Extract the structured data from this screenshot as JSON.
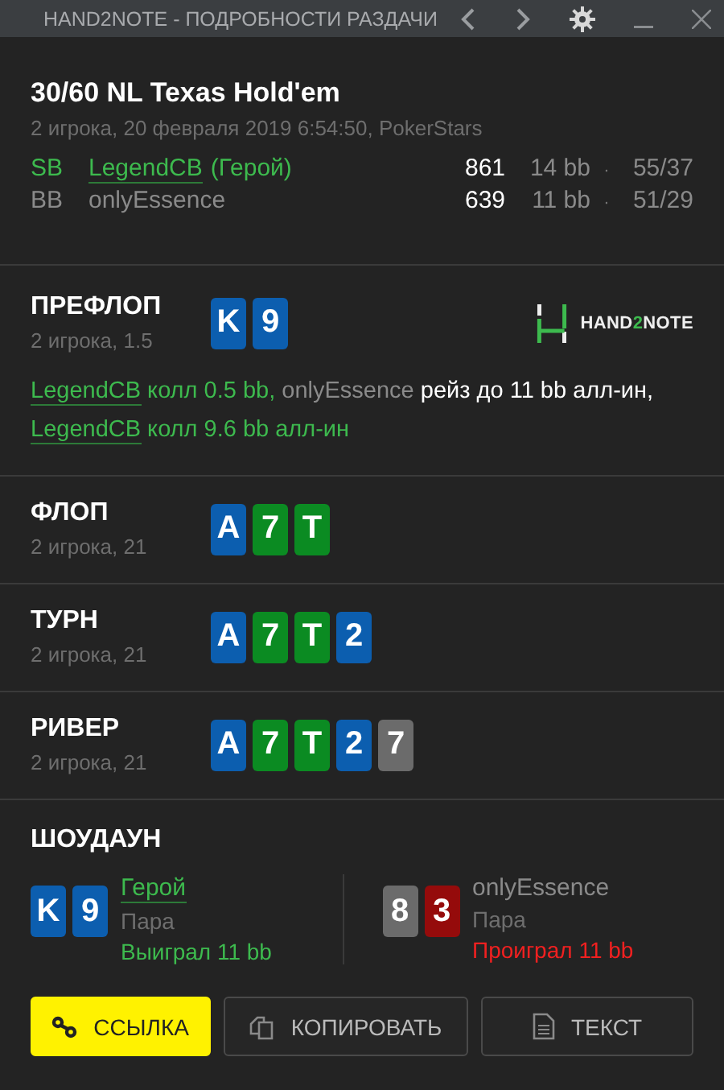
{
  "window": {
    "title": "HAND2NOTE - ПОДРОБНОСТИ РАЗДАЧИ"
  },
  "hand": {
    "title": "30/60 NL Texas Hold'em",
    "subtitle": "2 игрока, 20 февраля 2019 6:54:50, PokerStars",
    "players": [
      {
        "position": "SB",
        "name": "LegendCB",
        "tag": "(Герой)",
        "hero": true,
        "stack": "861",
        "bb": "14 bb",
        "sep": "·",
        "stats": "55/37"
      },
      {
        "position": "BB",
        "name": "onlyEssence",
        "hero": false,
        "stack": "639",
        "bb": "11 bb",
        "sep": "·",
        "stats": "51/29"
      }
    ]
  },
  "logo": {
    "text_a": "HAND",
    "text_b": "2",
    "text_c": "NOTE"
  },
  "streets": [
    {
      "name": "ПРЕФЛОП",
      "info": "2 игрока, 1.5",
      "cards": [
        {
          "rank": "K",
          "color": "#0c5eaf"
        },
        {
          "rank": "9",
          "color": "#0c5eaf"
        }
      ],
      "actions": [
        {
          "kind": "hero",
          "text": "LegendCB"
        },
        {
          "kind": "hero_action",
          "text": " колл 0.5 bb, "
        },
        {
          "kind": "villain",
          "text": "onlyEssence"
        },
        {
          "kind": "villain_action",
          "text": " рейз до 11 bb алл-ин, "
        },
        {
          "kind": "hero",
          "text": "LegendCB"
        },
        {
          "kind": "hero_action",
          "text": " колл 9.6 bb алл-ин"
        }
      ]
    },
    {
      "name": "ФЛОП",
      "info": "2 игрока, 21",
      "cards": [
        {
          "rank": "A",
          "color": "#0c5eaf"
        },
        {
          "rank": "7",
          "color": "#0b8b22"
        },
        {
          "rank": "T",
          "color": "#0b8b22"
        }
      ]
    },
    {
      "name": "ТУРН",
      "info": "2 игрока, 21",
      "cards": [
        {
          "rank": "A",
          "color": "#0c5eaf"
        },
        {
          "rank": "7",
          "color": "#0b8b22"
        },
        {
          "rank": "T",
          "color": "#0b8b22"
        },
        {
          "rank": "2",
          "color": "#0c5eaf"
        }
      ]
    },
    {
      "name": "РИВЕР",
      "info": "2 игрока, 21",
      "cards": [
        {
          "rank": "A",
          "color": "#0c5eaf"
        },
        {
          "rank": "7",
          "color": "#0b8b22"
        },
        {
          "rank": "T",
          "color": "#0b8b22"
        },
        {
          "rank": "2",
          "color": "#0c5eaf"
        },
        {
          "rank": "7",
          "color": "#6b6b6b"
        }
      ]
    }
  ],
  "showdown": {
    "title": "ШОУДАУН",
    "hands": [
      {
        "cards": [
          {
            "rank": "K",
            "color": "#0c5eaf"
          },
          {
            "rank": "9",
            "color": "#0c5eaf"
          }
        ],
        "name": "Герой",
        "hero": true,
        "combo": "Пара",
        "amount": "Выиграл 11 bb"
      },
      {
        "cards": [
          {
            "rank": "8",
            "color": "#6b6b6b"
          },
          {
            "rank": "3",
            "color": "#950b0b"
          }
        ],
        "name": "onlyEssence",
        "hero": false,
        "combo": "Пара",
        "amount": "Проиграл 11 bb"
      }
    ]
  },
  "buttons": [
    {
      "label": "ССЫЛКА",
      "kind": "primary"
    },
    {
      "label": "КОПИРОВАТЬ",
      "kind": "secondary"
    },
    {
      "label": "ТЕКСТ",
      "kind": "secondary"
    }
  ]
}
